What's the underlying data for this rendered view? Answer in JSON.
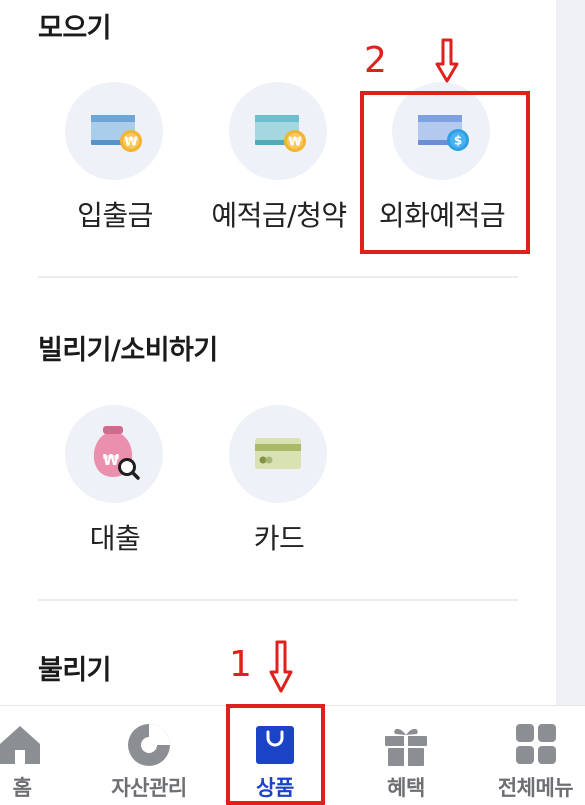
{
  "sections": {
    "save": {
      "title": "모으기",
      "items": [
        {
          "label": "입출금",
          "icon": "bank-card-won-icon"
        },
        {
          "label": "예적금/청약",
          "icon": "savings-card-won-icon"
        },
        {
          "label": "외화예적금",
          "icon": "foreign-currency-card-dollar-icon"
        }
      ]
    },
    "borrow": {
      "title": "빌리기/소비하기",
      "items": [
        {
          "label": "대출",
          "icon": "loan-bag-search-icon"
        },
        {
          "label": "카드",
          "icon": "credit-card-icon"
        }
      ]
    },
    "grow": {
      "title": "불리기"
    }
  },
  "annotations": {
    "step1": "1",
    "step2": "2"
  },
  "bottom_nav": {
    "items": [
      {
        "label": "홈",
        "icon": "home-icon"
      },
      {
        "label": "자산관리",
        "icon": "pie-chart-icon"
      },
      {
        "label": "상품",
        "icon": "shopping-bag-icon"
      },
      {
        "label": "혜택",
        "icon": "gift-icon"
      },
      {
        "label": "전체메뉴",
        "icon": "grid-menu-icon"
      }
    ],
    "active": "상품"
  },
  "colors": {
    "accent": "#1a43c8",
    "annotation_red": "#e0201d",
    "icon_circle_bg": "#eef1f7",
    "nav_inactive": "#6d6f73"
  }
}
